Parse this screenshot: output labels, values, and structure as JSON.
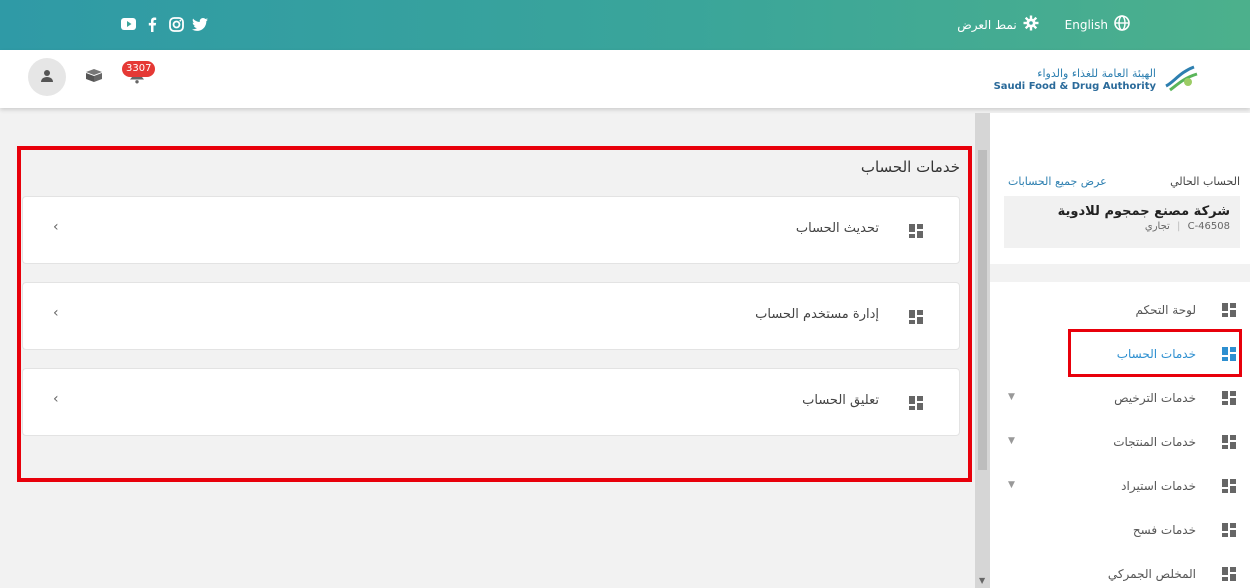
{
  "topbar": {
    "language_label": "English",
    "display_mode_label": "نمط العرض",
    "social_icons": [
      "youtube-icon",
      "facebook-icon",
      "instagram-icon",
      "twitter-icon"
    ]
  },
  "header": {
    "logo_ar": "الهيئة العامة للغذاء والدواء",
    "logo_en": "Saudi Food & Drug Authority",
    "notification_count": "3307"
  },
  "sidebar": {
    "current_account_label": "الحساب الحالي",
    "all_accounts_link": "عرض جميع الحسابات",
    "account_name": "شركة مصنع جمجوم للادوية",
    "account_id": "C-46508",
    "account_type": "تجاري",
    "menu": [
      {
        "label": "لوحة التحكم",
        "active": false,
        "has_caret": false
      },
      {
        "label": "خدمات الحساب",
        "active": true,
        "has_caret": false
      },
      {
        "label": "خدمات الترخيص",
        "active": false,
        "has_caret": true
      },
      {
        "label": "خدمات المنتجات",
        "active": false,
        "has_caret": true
      },
      {
        "label": "خدمات استيراد",
        "active": false,
        "has_caret": true
      },
      {
        "label": "خدمات فسح",
        "active": false,
        "has_caret": false
      },
      {
        "label": "المخلص الجمركي",
        "active": false,
        "has_caret": false
      }
    ]
  },
  "main": {
    "title": "خدمات الحساب",
    "cards": [
      {
        "label": "تحديث الحساب"
      },
      {
        "label": "إدارة مستخدم الحساب"
      },
      {
        "label": "تعليق الحساب"
      }
    ]
  },
  "colors": {
    "topbar_start": "#2f9aa6",
    "topbar_end": "#4cb08c",
    "highlight": "#e8000b",
    "active_link": "#2d8fd0",
    "badge": "#e53935"
  }
}
